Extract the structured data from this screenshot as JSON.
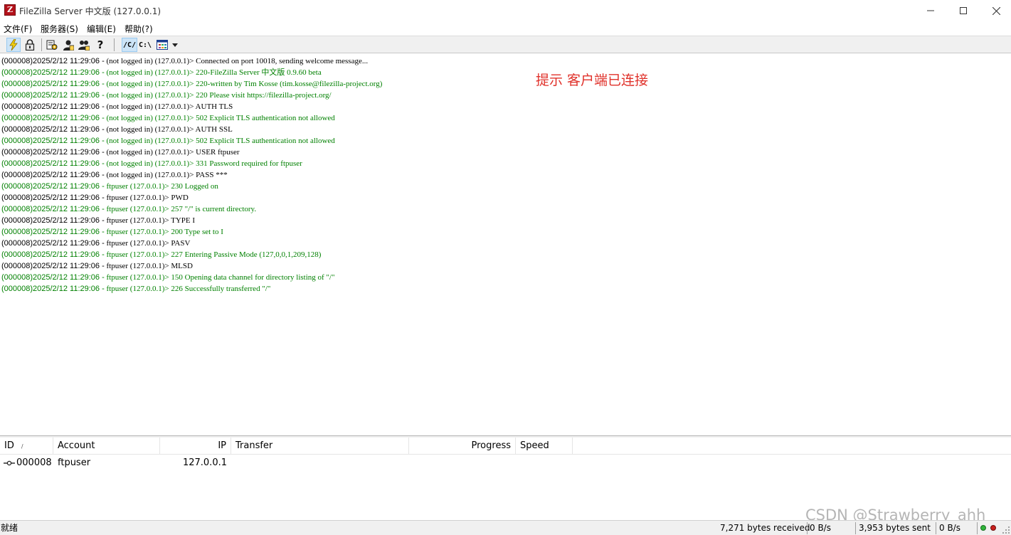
{
  "window": {
    "title": "FileZilla Server 中文版 (127.0.0.1)",
    "icon": "filezilla-server-icon",
    "icon_glyph": "Z",
    "controls": [
      "minimize-icon",
      "maximize-icon",
      "close-icon"
    ]
  },
  "menu": {
    "file": "文件(F)",
    "server": "服务器(S)",
    "edit": "编辑(E)",
    "help": "帮助(?)"
  },
  "toolbar": {
    "buttons": [
      {
        "icon": "lightning-icon",
        "pressed": true
      },
      {
        "icon": "lock-icon",
        "pressed": false
      },
      {
        "icon": "settings-icon",
        "pressed": false
      },
      {
        "icon": "users-icon",
        "pressed": false
      },
      {
        "icon": "groups-icon",
        "pressed": false
      },
      {
        "icon": "help-icon",
        "pressed": false
      },
      {
        "icon": "unix-path-icon",
        "pressed": true
      },
      {
        "icon": "windows-path-icon",
        "pressed": false
      },
      {
        "icon": "sort-grid-icon",
        "pressed": false
      },
      {
        "icon": "dropdown-arrow-icon",
        "pressed": false
      }
    ],
    "unix_path_label": "/C/",
    "windows_path_label": "C:\\",
    "help_glyph": "?"
  },
  "log": {
    "annotation": "提示 客户端已连接",
    "lines": [
      {
        "ts": "(000008)2025/2/12 11:29:06 -",
        "text": " (not logged in) (127.0.0.1)> Connected on port 10018, sending welcome message...",
        "color": "black"
      },
      {
        "ts": "(000008)2025/2/12 11:29:06 -",
        "text": " (not logged in) (127.0.0.1)> 220-FileZilla Server 中文版 0.9.60 beta",
        "color": "green"
      },
      {
        "ts": "(000008)2025/2/12 11:29:06 -",
        "text": " (not logged in) (127.0.0.1)> 220-written by Tim Kosse (tim.kosse@filezilla-project.org)",
        "color": "green"
      },
      {
        "ts": "(000008)2025/2/12 11:29:06 -",
        "text": " (not logged in) (127.0.0.1)> 220 Please visit https://filezilla-project.org/",
        "color": "green"
      },
      {
        "ts": "(000008)2025/2/12 11:29:06 -",
        "text": " (not logged in) (127.0.0.1)> AUTH TLS",
        "color": "black"
      },
      {
        "ts": "(000008)2025/2/12 11:29:06 -",
        "text": " (not logged in) (127.0.0.1)> 502 Explicit TLS authentication not allowed",
        "color": "green"
      },
      {
        "ts": "(000008)2025/2/12 11:29:06 -",
        "text": " (not logged in) (127.0.0.1)> AUTH SSL",
        "color": "black"
      },
      {
        "ts": "(000008)2025/2/12 11:29:06 -",
        "text": " (not logged in) (127.0.0.1)> 502 Explicit TLS authentication not allowed",
        "color": "green"
      },
      {
        "ts": "(000008)2025/2/12 11:29:06 -",
        "text": " (not logged in) (127.0.0.1)> USER ftpuser",
        "color": "black"
      },
      {
        "ts": "(000008)2025/2/12 11:29:06 -",
        "text": " (not logged in) (127.0.0.1)> 331 Password required for ftpuser",
        "color": "green"
      },
      {
        "ts": "(000008)2025/2/12 11:29:06 -",
        "text": " (not logged in) (127.0.0.1)> PASS ***",
        "color": "black"
      },
      {
        "ts": "(000008)2025/2/12 11:29:06 -",
        "text": " ftpuser (127.0.0.1)> 230 Logged on",
        "color": "green"
      },
      {
        "ts": "(000008)2025/2/12 11:29:06 -",
        "text": " ftpuser (127.0.0.1)> PWD",
        "color": "black"
      },
      {
        "ts": "(000008)2025/2/12 11:29:06 -",
        "text": " ftpuser (127.0.0.1)> 257 \"/\" is current directory.",
        "color": "green"
      },
      {
        "ts": "(000008)2025/2/12 11:29:06 -",
        "text": " ftpuser (127.0.0.1)> TYPE I",
        "color": "black"
      },
      {
        "ts": "(000008)2025/2/12 11:29:06 -",
        "text": " ftpuser (127.0.0.1)> 200 Type set to I",
        "color": "green"
      },
      {
        "ts": "(000008)2025/2/12 11:29:06 -",
        "text": " ftpuser (127.0.0.1)> PASV",
        "color": "black"
      },
      {
        "ts": "(000008)2025/2/12 11:29:06 -",
        "text": " ftpuser (127.0.0.1)> 227 Entering Passive Mode (127,0,0,1,209,128)",
        "color": "green"
      },
      {
        "ts": "(000008)2025/2/12 11:29:06 -",
        "text": " ftpuser (127.0.0.1)> MLSD",
        "color": "black"
      },
      {
        "ts": "(000008)2025/2/12 11:29:06 -",
        "text": " ftpuser (127.0.0.1)> 150 Opening data channel for directory listing of \"/\"",
        "color": "green"
      },
      {
        "ts": "(000008)2025/2/12 11:29:06 -",
        "text": " ftpuser (127.0.0.1)> 226 Successfully transferred \"/\"",
        "color": "green"
      }
    ]
  },
  "sessions": {
    "columns": {
      "id": "ID",
      "account": "Account",
      "ip": "IP",
      "transfer": "Transfer",
      "progress": "Progress",
      "speed": "Speed"
    },
    "sort_indicator": "/",
    "rows": [
      {
        "id": "000008",
        "account": "ftpuser",
        "ip": "127.0.0.1",
        "icon": "connection-plug-icon"
      }
    ]
  },
  "statusbar": {
    "ready": "就绪",
    "bytes_received": "7,271 bytes received",
    "recv_rate": "0 B/s",
    "bytes_sent": "3,953 bytes sent",
    "sent_rate": "0 B/s"
  },
  "watermark": "CSDN @Strawberry_ahh",
  "colors": {
    "log_green": "#008000",
    "annotation_red": "#e0312a",
    "pressed_bg": "#cce4f7"
  }
}
